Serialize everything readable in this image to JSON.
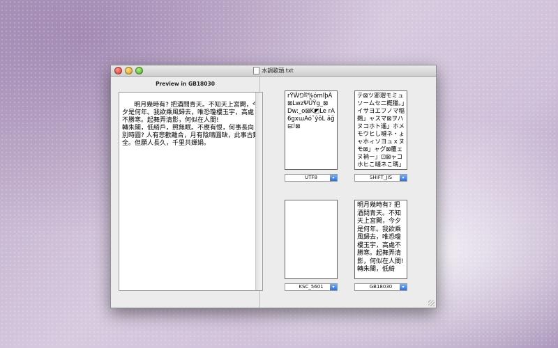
{
  "window": {
    "title": "水調歌頭.txt"
  },
  "preview": {
    "header": "Preview in GB18030",
    "text": "明月幾時有? 把酒問青天。不知天上宮闕，今夕是何年。我欲乘風歸去，唯恐瓊樓玉宇，高處不勝寒。起舞弄清影，何似在人間!\n轉朱閣，低綺戶，照無眠。不應有恨，何事長向別時圓? 人有悲歡離合，月有陰晴圓缺，此事古難全。但願人長久，千里共嬋娟。"
  },
  "encodings": [
    {
      "label": "UTF8",
      "text": "rŸŴ⅁ঈ%ómlþÀ⊠LwzΨǕŸg_⊠\nDw:_o⊠K◩Le rA6gxɯAóˇŷõL ãğ⊟ℐ⊠"
    },
    {
      "label": "SHIFT_JIS",
      "text": "テ⊠ツ邪瑁モミュソームセ二概獵。」イサヨエフノマ稲鵜」ャスマ⊠ヲハヌコホト遙」ホメモウヒし嗹ネ・ょャホィソヨュｘヌモ⊠」ャグ⊠覆ェヌ衲ー」⊡⊠ャコホヒこ嗹ネこ瑪」\n」ｓ…"
    },
    {
      "label": "KSC_5601",
      "text": ""
    },
    {
      "label": "GB18030",
      "text": "明月幾時有? 把酒問青天。不知天上宮闕，今夕是何年。我欲乘風歸去，唯恐瓊樓玉宇，高處不勝寒。起舞弄清影，何似在人間!\n轉朱閣，低綺"
    }
  ],
  "icons": {
    "close": "close-icon",
    "minimize": "minimize-icon",
    "zoom": "zoom-icon",
    "document": "document-icon",
    "dropdown": "chevron-down-icon",
    "resize": "resize-grip-icon"
  }
}
